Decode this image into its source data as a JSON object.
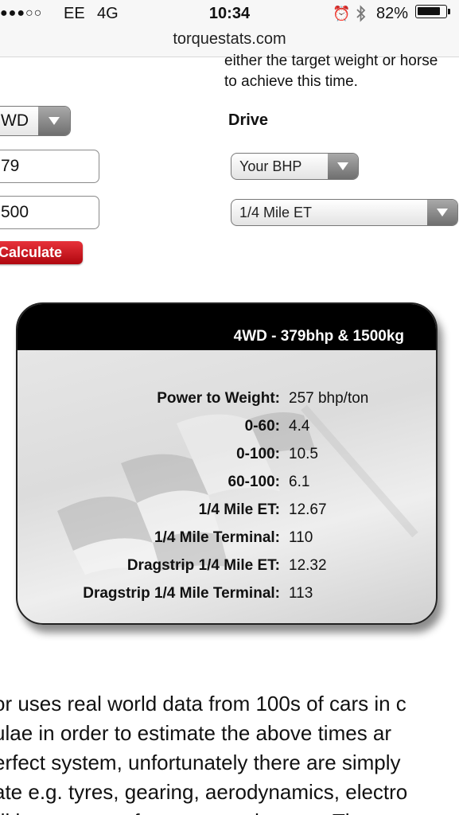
{
  "status_bar": {
    "signal": "●●●○○",
    "carrier": "EE",
    "network": "4G",
    "time": "10:34",
    "alarm_icon": "alarm-clock-icon",
    "bluetooth_icon": "bluetooth-icon",
    "battery_percent": "82%",
    "battery_level": 0.82
  },
  "browser": {
    "url": "torquestats.com"
  },
  "intro": {
    "line1": "either the target weight or horse",
    "line2": "to achieve this time."
  },
  "form": {
    "drive_select_value": "WD",
    "bhp_input_value": "79",
    "weight_input_value": "500",
    "calculate_label": "Calculate",
    "drive_label": "Drive",
    "target_select_value": "Your BHP",
    "time_select_value": "1/4 Mile ET"
  },
  "results": {
    "title": "4WD - 379bhp & 1500kg",
    "rows": [
      {
        "label": "Power to Weight:",
        "value": "257 bhp/ton"
      },
      {
        "label": "0-60:",
        "value": "4.4"
      },
      {
        "label": "0-100:",
        "value": "10.5"
      },
      {
        "label": "60-100:",
        "value": "6.1"
      },
      {
        "label": "1/4 Mile ET:",
        "value": "12.67"
      },
      {
        "label": "1/4 Mile Terminal:",
        "value": "110"
      },
      {
        "label": "Dragstrip 1/4 Mile ET:",
        "value": "12.32"
      },
      {
        "label": "Dragstrip 1/4 Mile Terminal:",
        "value": "113"
      }
    ]
  },
  "paragraph": {
    "lines": [
      "or uses real world data from 100s of cars in c",
      "ulae in order to estimate the above times ar",
      "erfect system, unfortunately there are simply",
      "ate e.g. tyres, gearing, aerodynamics, electro",
      "ditions, any performance tuning, etc. Th"
    ]
  },
  "colors": {
    "calculate_button": "#c8101a",
    "card_header": "#000000",
    "status_bar_bg": "#f7f7f7"
  }
}
